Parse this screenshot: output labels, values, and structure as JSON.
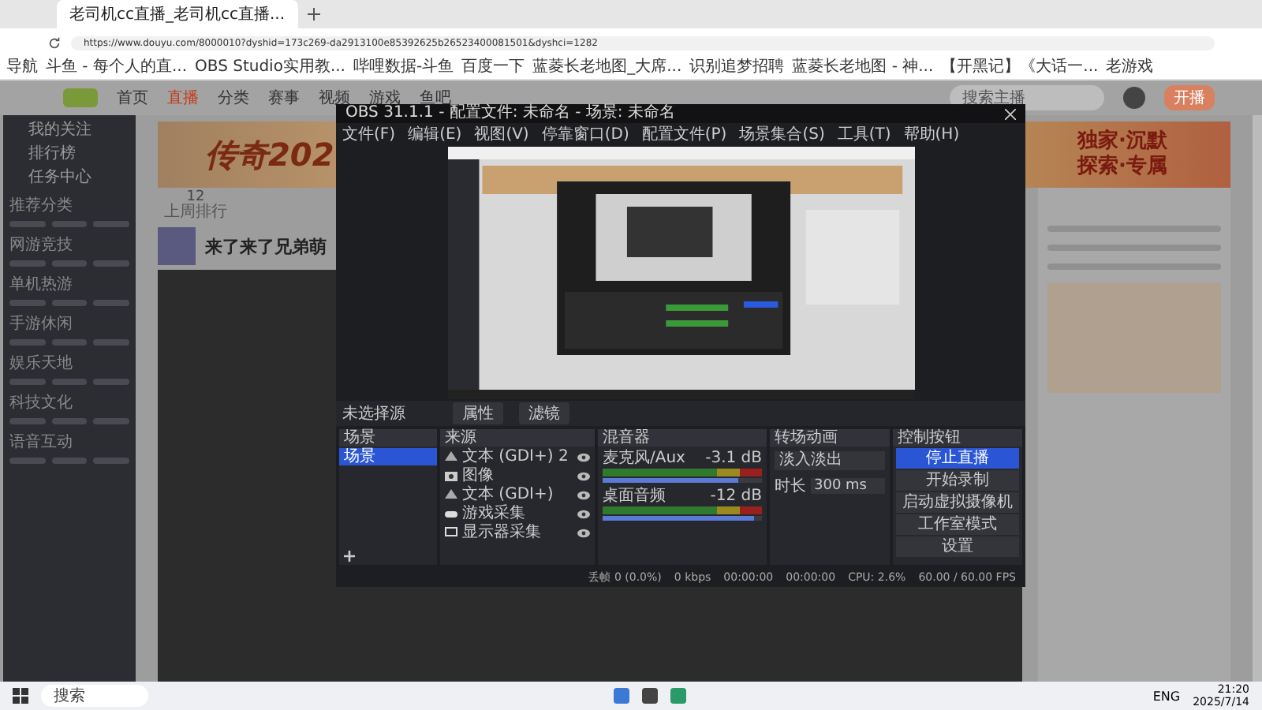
{
  "browser": {
    "tab_title": "老司机cc直播_老司机cc直播...",
    "url": "https://www.douyu.com/8000010?dyshid=173c269-da2913100e85392625b26523400081501&dyshci=1282",
    "bookmarks": [
      "导航",
      "斗鱼 - 每个人的直...",
      "OBS Studio实用教...",
      "哔哩数据-斗鱼",
      "百度一下",
      "蓝菱长老地图_大席...",
      "识别追梦招聘",
      "蓝菱长老地图 - 神...",
      "【开黑记】《大话一...",
      "老游戏"
    ]
  },
  "site": {
    "nav": [
      {
        "label": "首页",
        "selected": false
      },
      {
        "label": "直播",
        "selected": true
      },
      {
        "label": "分类",
        "selected": false
      },
      {
        "label": "赛事",
        "selected": false
      },
      {
        "label": "视频",
        "selected": false
      },
      {
        "label": "游戏",
        "selected": false
      },
      {
        "label": "鱼吧",
        "selected": false
      }
    ],
    "search_placeholder": "搜索主播",
    "live_button": "开播",
    "sidebar": {
      "top": [
        "我的关注",
        "排行榜",
        "任务中心"
      ],
      "sections": [
        "推荐分类",
        "网游竞技",
        "单机热游",
        "手游休闲",
        "娱乐天地",
        "科技文化",
        "语音互动"
      ]
    },
    "banner": {
      "title": "传奇202",
      "slogans": [
        "独家·沉默",
        "探索·专属"
      ]
    },
    "room": {
      "rank_number": "12",
      "rank_label": "上周排行",
      "streamer_title": "来了来了兄弟萌"
    }
  },
  "obs": {
    "title": "OBS 31.1.1 - 配置文件: 未命名 - 场景: 未命名",
    "menu": [
      "文件(F)",
      "编辑(E)",
      "视图(V)",
      "停靠窗口(D)",
      "配置文件(P)",
      "场景集合(S)",
      "工具(T)",
      "帮助(H)"
    ],
    "context": {
      "label": "未选择源",
      "buttons": [
        "属性",
        "滤镜"
      ]
    },
    "docks": [
      "场景",
      "来源",
      "混音器",
      "转场动画",
      "控制按钮"
    ],
    "scenes": [
      {
        "name": "场景",
        "selected": true
      }
    ],
    "sources": [
      {
        "name": "文本 (GDI+) 2",
        "kind": "text"
      },
      {
        "name": "图像",
        "kind": "image"
      },
      {
        "name": "文本 (GDI+)",
        "kind": "text"
      },
      {
        "name": "游戏采集",
        "kind": "game"
      },
      {
        "name": "显示器采集",
        "kind": "display"
      }
    ],
    "mixer": [
      {
        "name": "麦克风/Aux",
        "reading": "-3.1 dB",
        "level": 0.85
      },
      {
        "name": "桌面音频",
        "reading": "-12 dB",
        "level": 0.95
      }
    ],
    "transition": {
      "type": "淡入淡出",
      "duration_label": "时长",
      "duration": "300 ms"
    },
    "controls": [
      {
        "label": "停止直播",
        "active": true
      },
      {
        "label": "开始录制",
        "active": false
      },
      {
        "label": "启动虚拟摄像机",
        "active": false
      },
      {
        "label": "工作室模式",
        "active": false
      },
      {
        "label": "设置",
        "active": false
      }
    ],
    "status": [
      "丢帧 0 (0.0%)",
      "0 kbps",
      "00:00:00",
      "00:00:00",
      "CPU: 2.6%",
      "60.00 / 60.00 FPS"
    ]
  },
  "taskbar": {
    "search": "搜索",
    "language": "ENG",
    "time": "21:20",
    "date": "2025/7/14"
  }
}
